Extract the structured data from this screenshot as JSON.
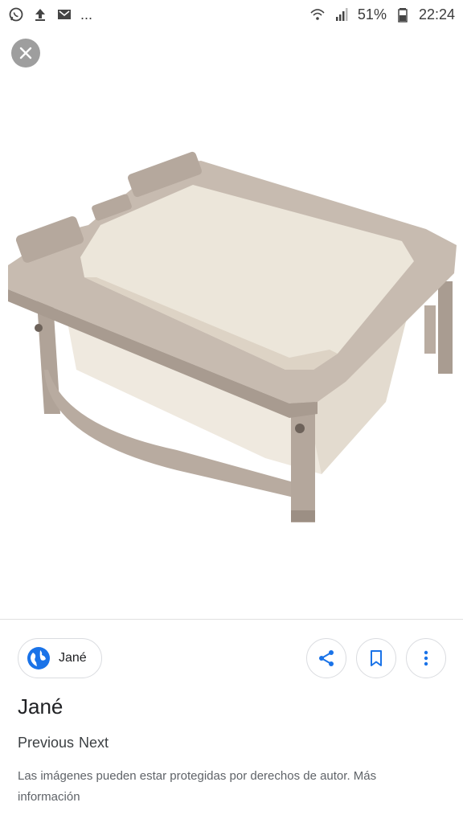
{
  "status_bar": {
    "battery": "51%",
    "time": "22:24",
    "overflow": "..."
  },
  "image": {
    "description_icon": "bathtub-image"
  },
  "source_chip": {
    "label": "Jané"
  },
  "title": "Jané",
  "nav": {
    "previous": "Previous",
    "next": "Next"
  },
  "copyright": {
    "text": "Las imágenes pueden estar protegidas por derechos de autor. ",
    "link": "Más información"
  },
  "colors": {
    "accent": "#1a73e8",
    "frame": "#b7a99e",
    "fabric": "#f2ece2"
  }
}
